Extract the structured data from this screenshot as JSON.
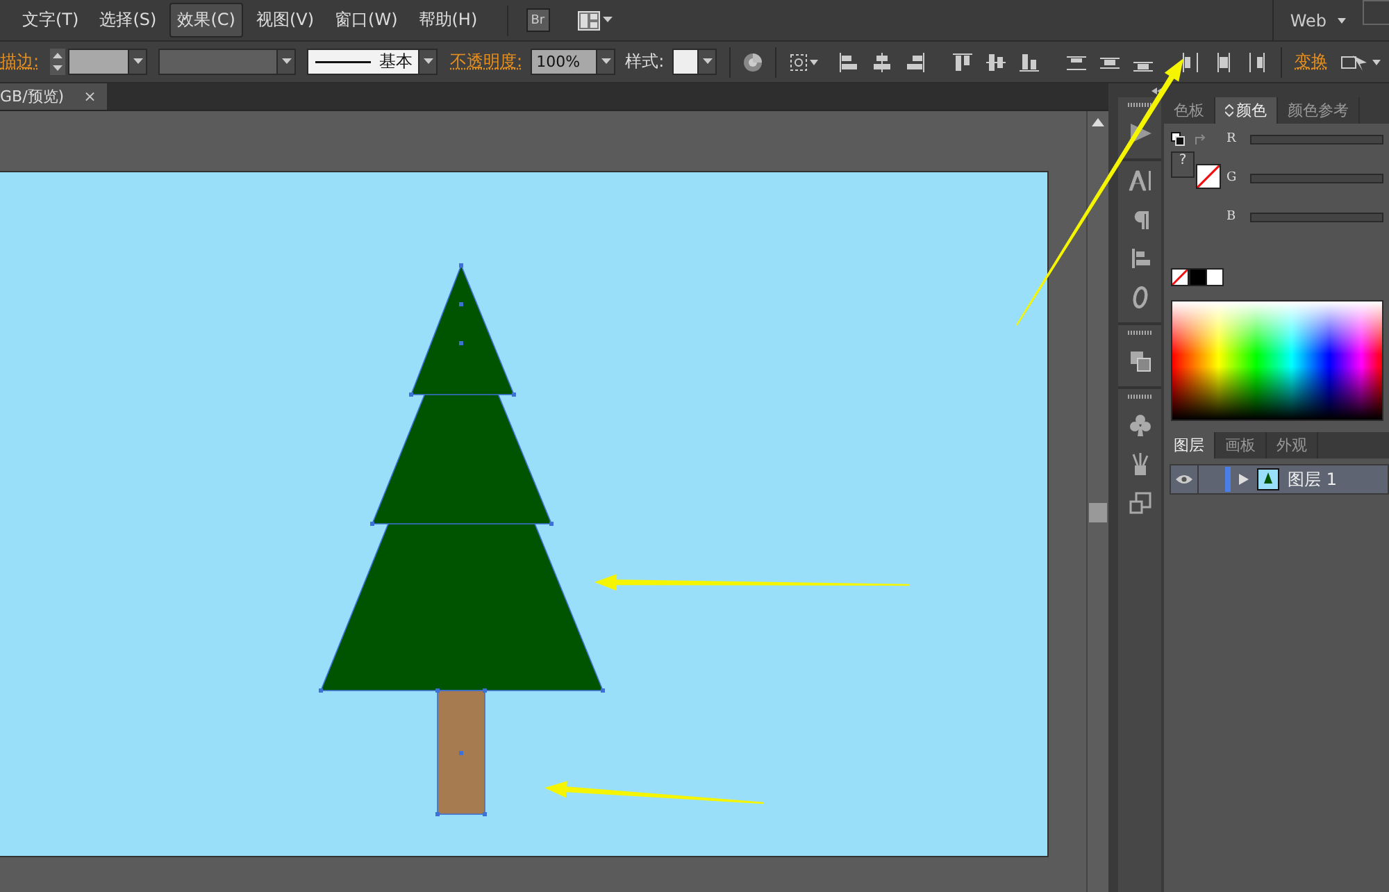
{
  "menu": [
    {
      "label": "文字(T)",
      "selected": false
    },
    {
      "label": "选择(S)",
      "selected": false
    },
    {
      "label": "效果(C)",
      "selected": true
    },
    {
      "label": "视图(V)",
      "selected": false
    },
    {
      "label": "窗口(W)",
      "selected": false
    },
    {
      "label": "帮助(H)",
      "selected": false
    }
  ],
  "bridge_button": "Br",
  "workspace": "Web",
  "control_bar": {
    "stroke_label": "描边:",
    "stroke_profile": "基本",
    "opacity_label": "不透明度:",
    "opacity_value": "100%",
    "style_label": "样式:",
    "transform_label": "变换"
  },
  "document_tab": {
    "title": "GB/预览)",
    "close": "×"
  },
  "color_panel": {
    "tabs": [
      {
        "label": "色板",
        "selected": false
      },
      {
        "label": "颜色",
        "selected": true
      },
      {
        "label": "颜色参考",
        "selected": false
      }
    ],
    "fill_unknown": "?",
    "channels": [
      {
        "label": "R",
        "level": 0
      },
      {
        "label": "G",
        "level": 0
      },
      {
        "label": "B",
        "level": 0
      }
    ]
  },
  "layers_panel": {
    "tabs": [
      {
        "label": "图层",
        "selected": true
      },
      {
        "label": "画板",
        "selected": false
      },
      {
        "label": "外观",
        "selected": false
      }
    ],
    "layers": [
      {
        "name": "图层 1",
        "visible": true,
        "expanded": false
      }
    ]
  }
}
